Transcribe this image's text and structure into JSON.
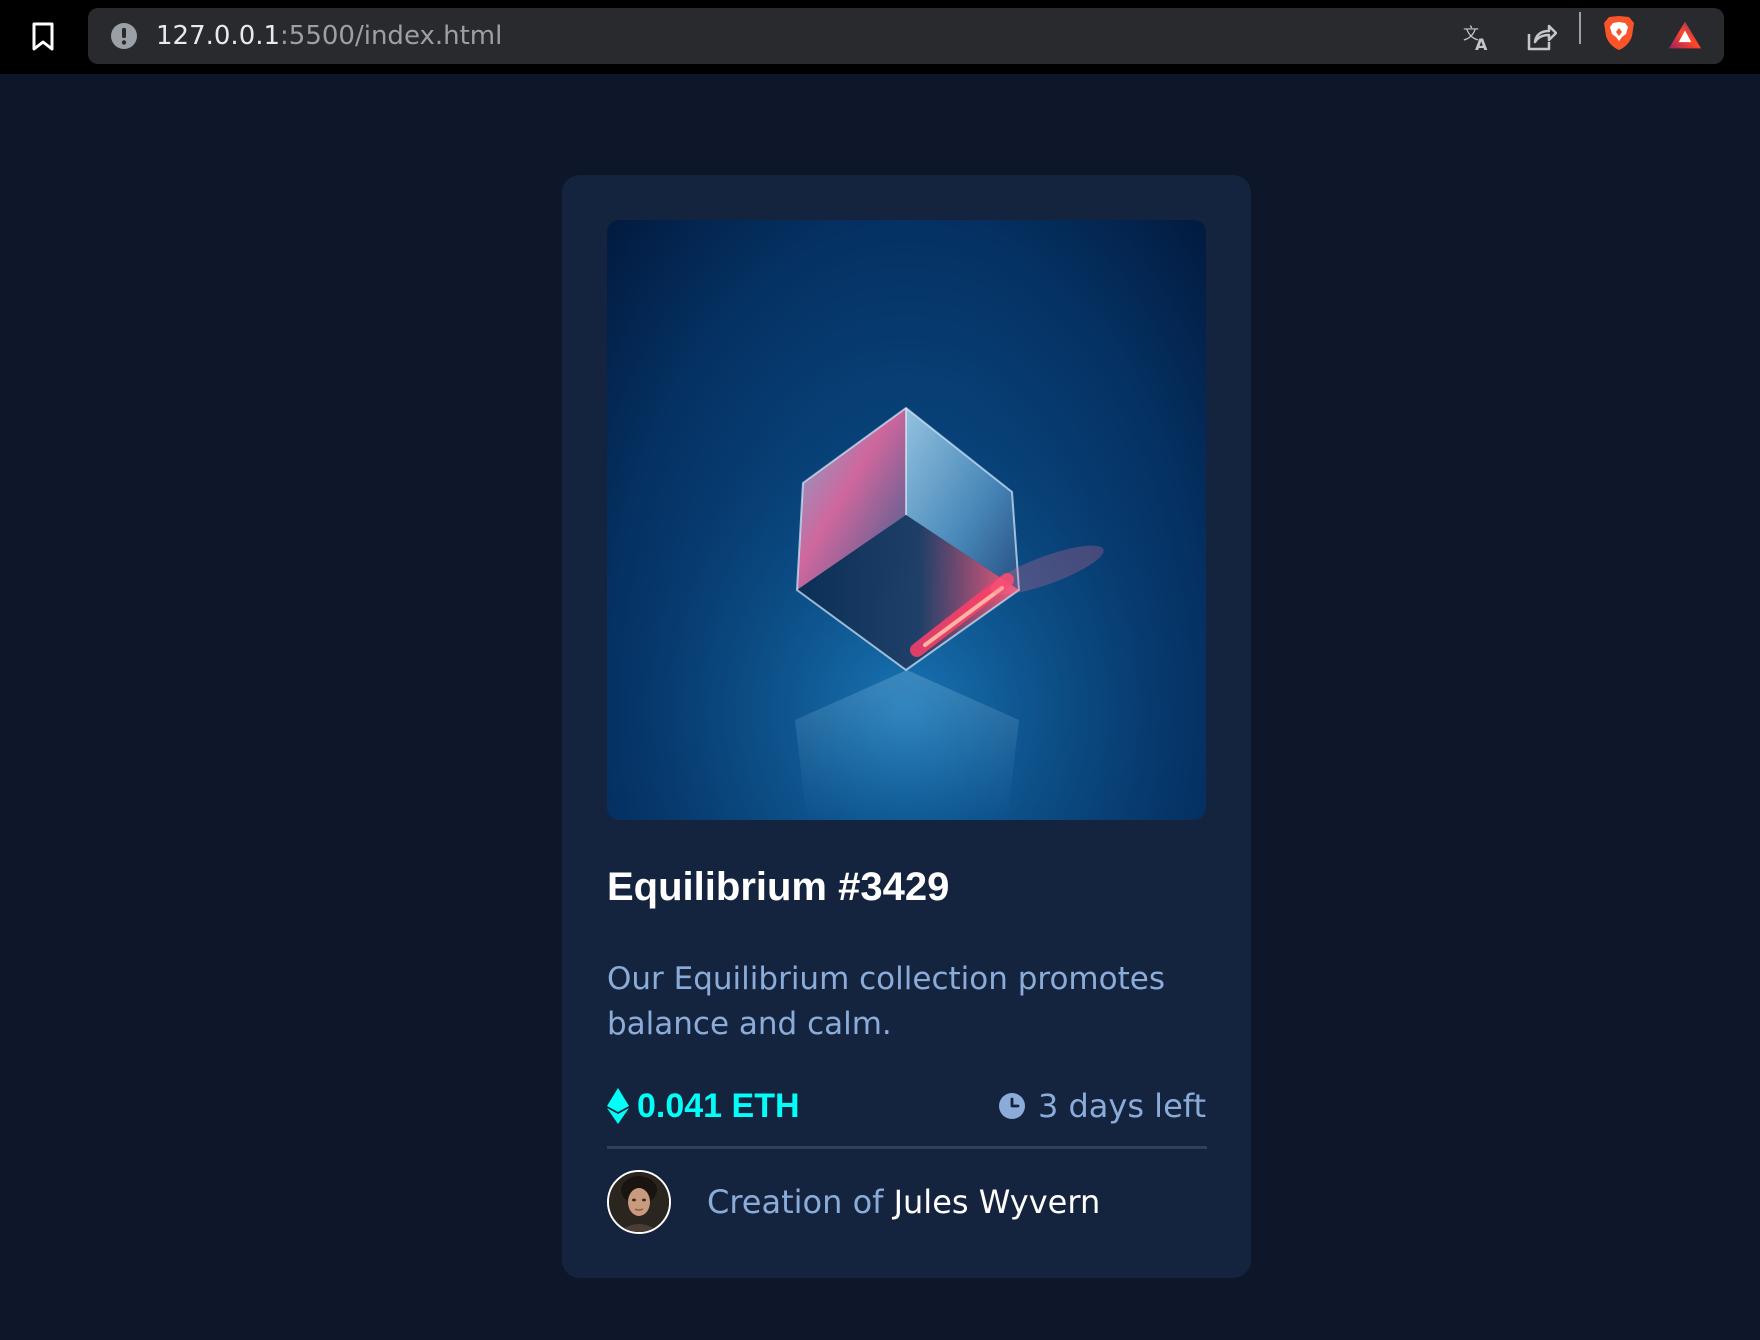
{
  "browser": {
    "url_host": "127.0.0.1",
    "url_rest": ":5500/index.html",
    "icons": [
      "bookmark-icon",
      "site-info-icon",
      "translate-icon",
      "share-icon",
      "brave-shields-icon",
      "brave-rewards-icon"
    ]
  },
  "card": {
    "image_alt": "Equilibrium cube",
    "title": "Equilibrium #3429",
    "description": "Our Equilibrium collection promotes balance and calm.",
    "price": "0.041 ETH",
    "time_left": "3 days left",
    "creator_prefix": "Creation of ",
    "creator_name": "Jules Wyvern"
  },
  "colors": {
    "page_bg": "#0d1729",
    "card_bg": "#15243e",
    "accent_cyan": "#00fff8",
    "soft_blue": "#8bacd9",
    "white": "#ffffff"
  }
}
